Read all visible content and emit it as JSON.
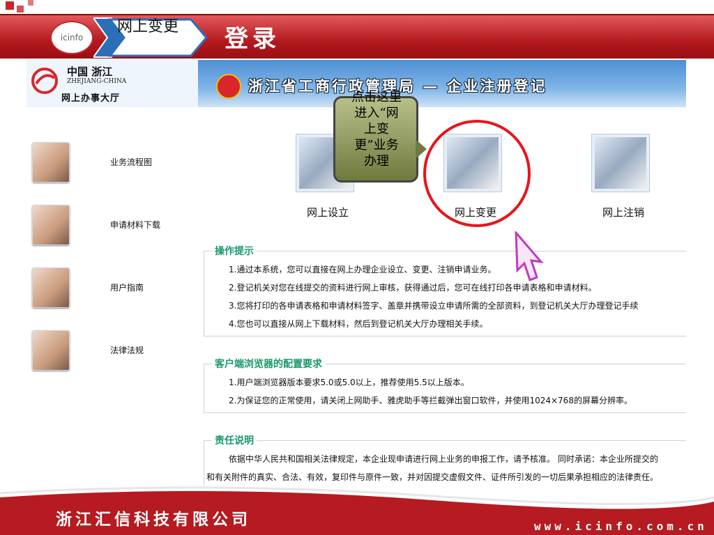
{
  "slide": {
    "breadcrumb": "网上变更",
    "title": "登录",
    "logo_text": "icinfo",
    "callout": "点击这里进入“网上变更”业务办理",
    "footer_company": "浙江汇信科技有限公司",
    "footer_url": "www.icinfo.com.cn"
  },
  "site": {
    "logo_cn": "中国 浙江",
    "logo_en": "ZHEJIANG-CHINA",
    "logo_sub": "网上办事大厅",
    "title": "浙江省工商行政管理局 — 企业注册登记"
  },
  "sidebar": {
    "items": [
      {
        "label": "业务流程图"
      },
      {
        "label": "申请材料下载"
      },
      {
        "label": "用户指南"
      },
      {
        "label": "法律法规"
      }
    ]
  },
  "services": [
    {
      "label": "网上设立"
    },
    {
      "label": "网上变更"
    },
    {
      "label": "网上注销"
    }
  ],
  "tips": {
    "title": "操作提示",
    "items": [
      "1.通过本系统，您可以直接在网上办理企业设立、变更、注销申请业务。",
      "2.登记机关对您在线提交的资料进行网上审核，获得通过后，您可在线打印各申请表格和申请材料。",
      "3.您将打印的各申请表格和申请材料签字、盖章并携带设立申请所需的全部资料，到登记机关大厅办理登记手续",
      "4.您也可以直接从网上下载材料，然后到登记机关大厅办理相关手续。"
    ]
  },
  "browser": {
    "title": "客户端浏览器的配置要求",
    "items": [
      "1.用户端浏览器版本要求5.0或5.0以上，推荐使用5.5以上版本。",
      "2.为保证您的正常使用，请关闭上网助手、雅虎助手等拦截弹出窗口软件，并使用1024×768的屏幕分辨率。"
    ]
  },
  "liability": {
    "title": "责任说明",
    "line1": "依据中华人民共和国相关法律规定，本企业现申请进行网上业务的申报工作，请予核准。  同时承诺：本企业所提交的",
    "line2": "和有关附件的真实、合法、有效，复印件与原件一致，并对因提交虚假文件、证件所引发的一切后果承担相应的法律责任。"
  },
  "colors": {
    "header_red": "#b3191e",
    "section_green": "#1a9a6a",
    "ring_red": "#e8141b",
    "site_blue": "#4e8ed2"
  }
}
